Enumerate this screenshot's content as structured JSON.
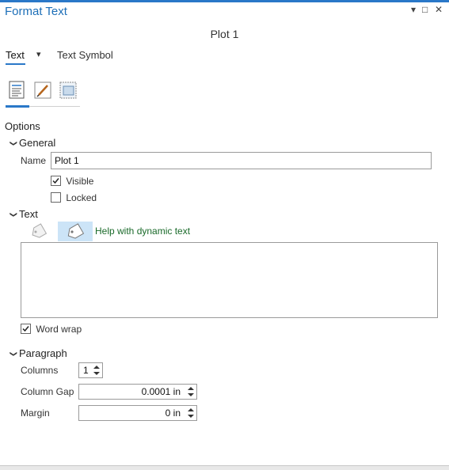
{
  "pane": {
    "title": "Format Text",
    "controls": {
      "menu": "▾",
      "maximize": "□",
      "close": "✕"
    }
  },
  "element_name": "Plot 1",
  "tabs": {
    "text": "Text",
    "dropdown": "▾",
    "text_symbol": "Text Symbol"
  },
  "subtabs": [
    {
      "icon": "text-properties-icon",
      "active": true
    },
    {
      "icon": "pen-icon",
      "active": false
    },
    {
      "icon": "display-icon",
      "active": false
    }
  ],
  "options_label": "Options",
  "general": {
    "heading": "General",
    "name_label": "Name",
    "name_value": "Plot 1",
    "visible_label": "Visible",
    "visible_checked": true,
    "locked_label": "Locked",
    "locked_checked": false
  },
  "text_section": {
    "heading": "Text",
    "help_link": "Help with dynamic text",
    "content": "",
    "word_wrap_label": "Word wrap",
    "word_wrap_checked": true
  },
  "paragraph": {
    "heading": "Paragraph",
    "columns_label": "Columns",
    "columns_value": "1",
    "column_gap_label": "Column Gap",
    "column_gap_value": "0.0001 in",
    "margin_label": "Margin",
    "margin_value": "0 in"
  },
  "colors": {
    "accent": "#2a78c8",
    "title": "#1d6fb8",
    "link": "#1a6a2a",
    "selected_bg": "#cce4f7"
  }
}
